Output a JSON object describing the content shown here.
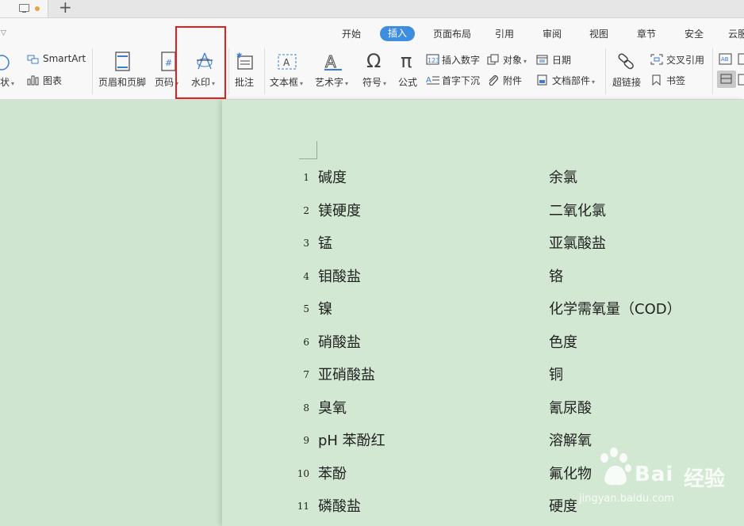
{
  "tabs": {
    "new_tab": "+"
  },
  "menu": {
    "items": [
      "开始",
      "插入",
      "页面布局",
      "引用",
      "审阅",
      "视图",
      "章节",
      "安全",
      "云服"
    ],
    "active": "插入"
  },
  "toolbar": {
    "shape_partial": "状",
    "smartart": "SmartArt",
    "chart": "图表",
    "header_footer": "页眉和页脚",
    "page_number": "页码",
    "watermark": "水印",
    "comment": "批注",
    "textbox": "文本框",
    "wordart": "艺术字",
    "symbol": "符号",
    "formula": "公式",
    "insert_number": "插入数字",
    "drop_cap": "首字下沉",
    "object": "对象",
    "attachment": "附件",
    "date": "日期",
    "doc_parts": "文档部件",
    "hyperlink": "超链接",
    "cross_reference": "交叉引用",
    "bookmark": "书签"
  },
  "accent_color": "#3e8ee0",
  "highlight_color": "#e02020",
  "document": {
    "rows": [
      {
        "num": "1",
        "left": "碱度",
        "right": "余氯"
      },
      {
        "num": "2",
        "left": "镁硬度",
        "right": "二氧化氯"
      },
      {
        "num": "3",
        "left": "锰",
        "right": "亚氯酸盐"
      },
      {
        "num": "4",
        "left": "钼酸盐",
        "right": "铬"
      },
      {
        "num": "5",
        "left": "镍",
        "right": "化学需氧量（COD）"
      },
      {
        "num": "6",
        "left": "硝酸盐",
        "right": "色度"
      },
      {
        "num": "7",
        "left": "亚硝酸盐",
        "right": "铜"
      },
      {
        "num": "8",
        "left": "臭氧",
        "right": "氰尿酸"
      },
      {
        "num": "9",
        "left": "pH 苯酚红",
        "right": "溶解氧"
      },
      {
        "num": "10",
        "left": "苯酚",
        "right": "氟化物"
      },
      {
        "num": "11",
        "left": "磷酸盐",
        "right": "硬度"
      }
    ]
  },
  "watermark": {
    "brand": "Bai",
    "brand_cn": "经验",
    "url": "jingyan.baidu.com"
  }
}
